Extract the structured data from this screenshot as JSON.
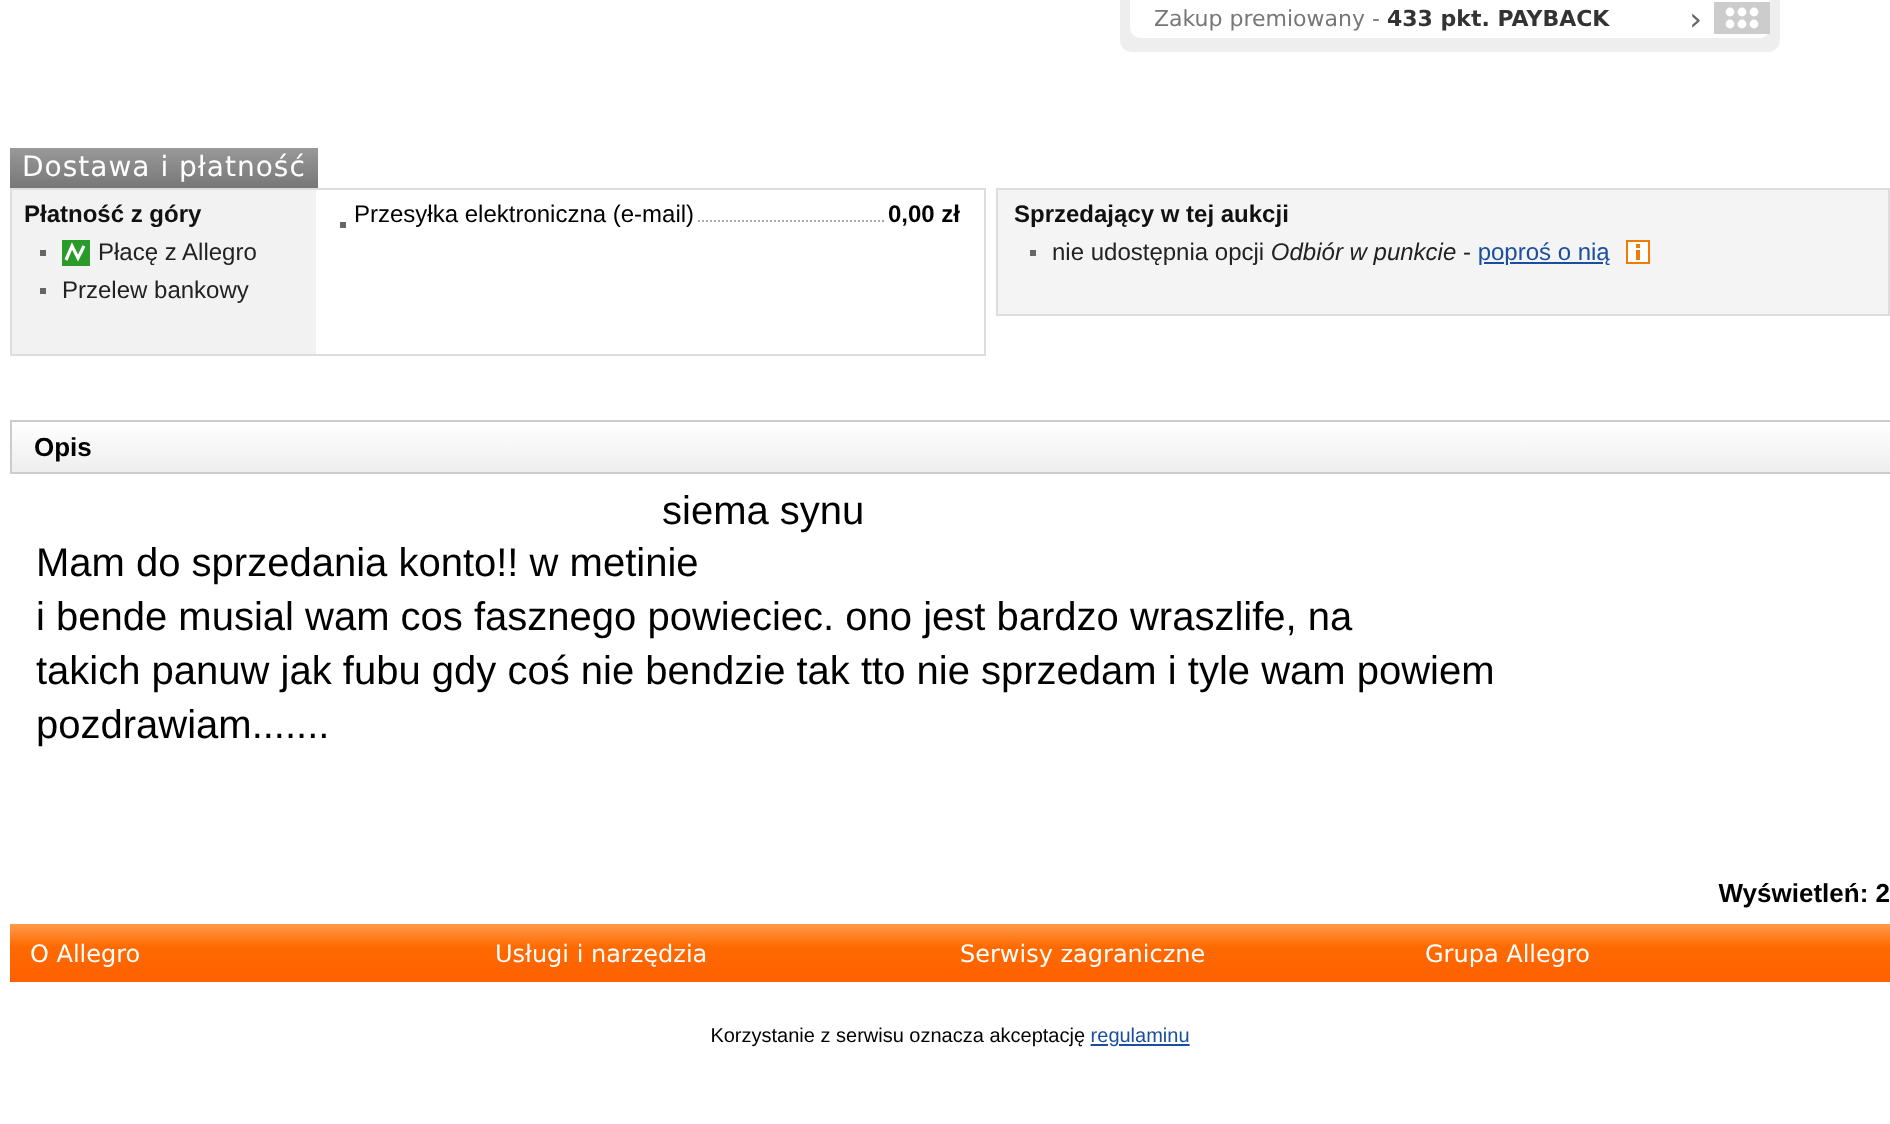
{
  "promo": {
    "text": "Zakup premiowany - ",
    "points": "433 pkt. PAYBACK",
    "arrow": "›"
  },
  "delivery": {
    "title": "Dostawa i płatność",
    "payment": {
      "title": "Płatność z góry",
      "methods": [
        {
          "label": "Płacę z Allegro",
          "kind": "icon"
        },
        {
          "label": "Przelew bankowy",
          "kind": "plain"
        }
      ]
    },
    "shipping": [
      {
        "label": "Przesyłka elektroniczna (e-mail)",
        "price": "0,00 zł"
      }
    ],
    "seller": {
      "title": "Sprzedający w tej aukcji",
      "note": "nie udostępnia opcji *Odbiór w punkcie* - ",
      "link": "poproś o nią"
    }
  },
  "description": {
    "title": "Opis",
    "heading": "siema synu",
    "lines": [
      "Mam do sprzedania konto!! w metinie",
      "i bende musial wam cos fasznego powieciec. ono jest bardzo wraszlife, na",
      "takich panuw jak fubu gdy coś nie  bendzie tak tto nie sprzedam i tyle wam powiem",
      "pozdrawiam......."
    ],
    "views": "Wyświetleń: 2"
  },
  "footer_nav": [
    "O Allegro",
    "Usługi i narzędzia",
    "Serwisy zagraniczne",
    "Grupa Allegro"
  ],
  "terms": {
    "text": "Korzystanie z serwisu oznacza akceptację ",
    "link": "regulaminu"
  }
}
